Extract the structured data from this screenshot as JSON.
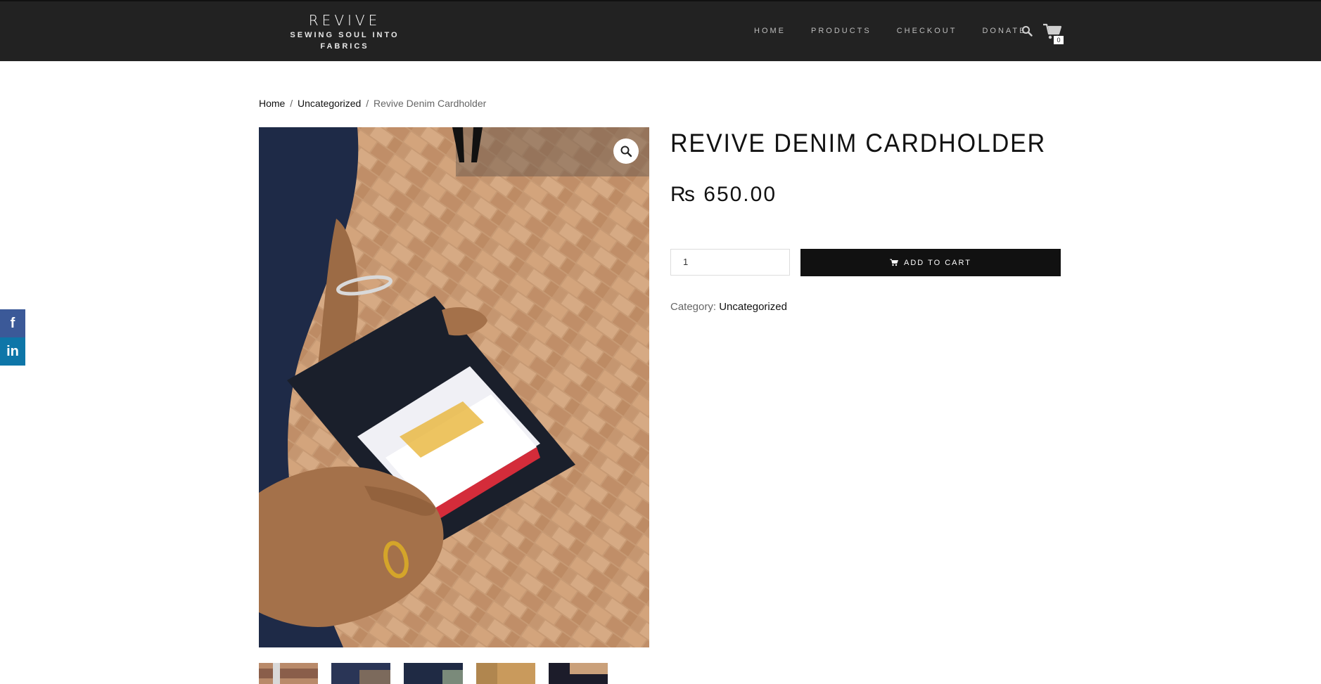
{
  "site": {
    "title": "REVIVE",
    "tagline_line1": "SEWING SOUL INTO",
    "tagline_line2": "FABRICS"
  },
  "nav": {
    "items": [
      {
        "label": "HOME"
      },
      {
        "label": "PRODUCTS"
      },
      {
        "label": "CHECKOUT"
      },
      {
        "label": "DONATE"
      }
    ]
  },
  "cart": {
    "count": "0"
  },
  "breadcrumb": {
    "home": "Home",
    "category": "Uncategorized",
    "current": "Revive Denim Cardholder",
    "separator": "/"
  },
  "product": {
    "title": "REVIVE DENIM CARDHOLDER",
    "price": "₨ 650.00",
    "quantity": "1",
    "add_to_cart_label": "ADD TO CART",
    "category_label": "Category:",
    "category_value": "Uncategorized"
  },
  "social": {
    "facebook_label": "f",
    "linkedin_label": "in"
  },
  "colors": {
    "header_bg": "#222222",
    "button_bg": "#111111",
    "facebook": "#3b5998",
    "linkedin": "#0e76a8"
  }
}
